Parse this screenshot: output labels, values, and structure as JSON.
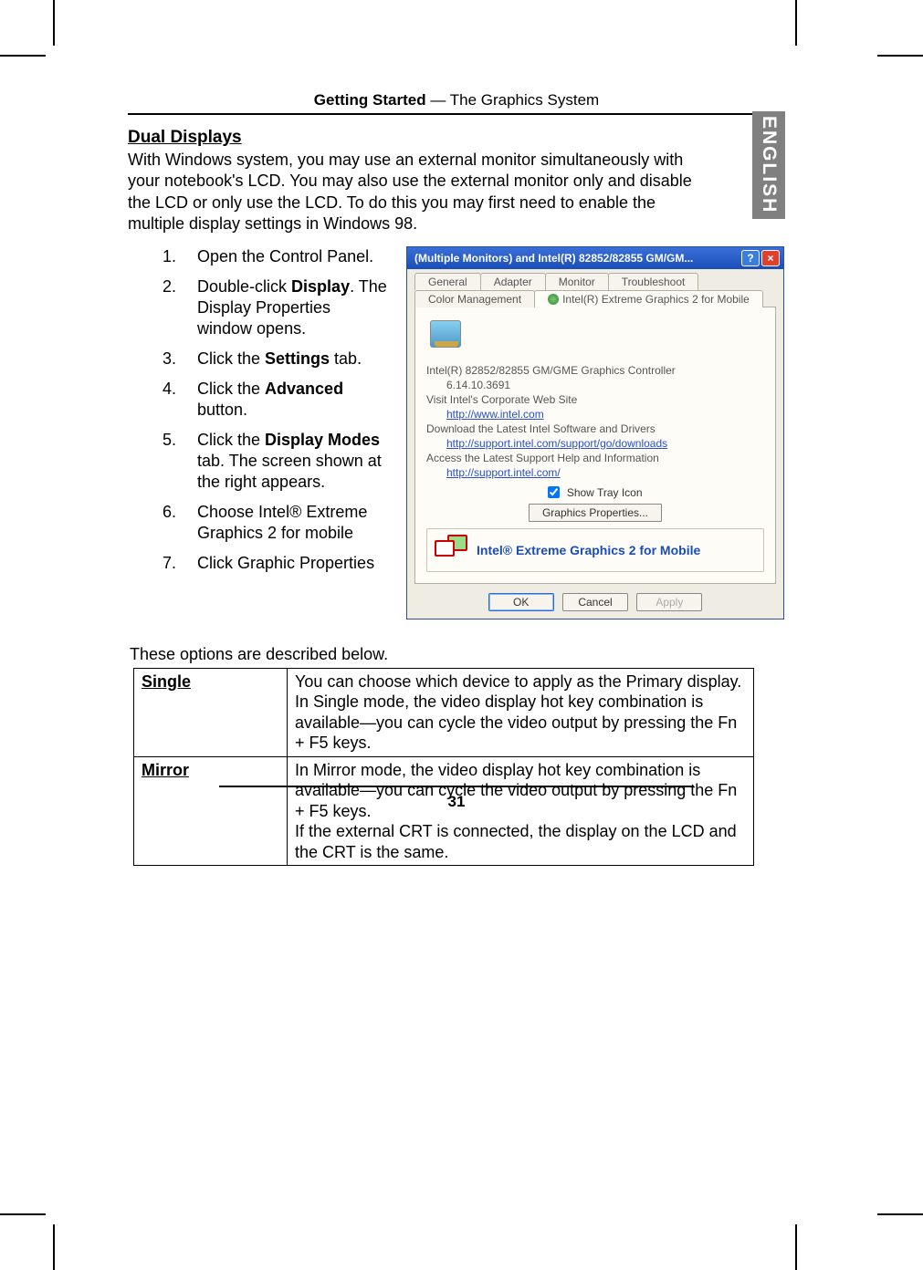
{
  "header": {
    "chapter": "Getting Started",
    "section": "The Graphics System"
  },
  "side_tab": "ENGLISH",
  "title": "Dual Displays",
  "intro": "With Windows system, you may use an external monitor simultaneously with your notebook's LCD. You may also use the external monitor only and disable the LCD or only use the LCD. To do this you may first need to enable the multiple display settings in Windows 98.",
  "steps": [
    {
      "n": "1.",
      "html": "Open the Control Panel."
    },
    {
      "n": "2.",
      "html": "Double-click <b>Display</b>. The Display Properties window opens."
    },
    {
      "n": "3.",
      "html": "Click the <b>Settings</b> tab."
    },
    {
      "n": "4.",
      "html": "Click the <b>Advanced</b> button."
    },
    {
      "n": "5.",
      "html": "Click the <b>Display Modes</b> tab. The screen shown at the right appears."
    },
    {
      "n": "6.",
      "html": "Choose Intel® Extreme Graphics 2 for mobile"
    },
    {
      "n": "7.",
      "html": "Click Graphic Properties"
    }
  ],
  "dialog": {
    "title": "(Multiple Monitors) and Intel(R) 82852/82855 GM/GM...",
    "tabs_row1": [
      "General",
      "Adapter",
      "Monitor",
      "Troubleshoot"
    ],
    "tabs_row2": [
      "Color Management",
      "Intel(R) Extreme Graphics 2 for Mobile"
    ],
    "controller": "Intel(R) 82852/82855 GM/GME Graphics Controller",
    "version": "6.14.10.3691",
    "visit_label": "Visit Intel's Corporate Web Site",
    "visit_link": "http://www.intel.com",
    "download_label": "Download the Latest Intel Software and Drivers",
    "download_link": "http://support.intel.com/support/go/downloads",
    "support_label": "Access the Latest Support Help and Information",
    "support_link": "http://support.intel.com/",
    "tray_label": "Show Tray Icon",
    "gp_button": "Graphics Properties...",
    "brand": "Intel® Extreme Graphics 2 for Mobile",
    "ok": "OK",
    "cancel": "Cancel",
    "apply": "Apply"
  },
  "options_intro": "These options are described below.",
  "options": [
    {
      "k": "Single",
      "v": "You can choose which device to apply as the Primary display.\nIn Single mode, the video display hot key combination is available—you can cycle the video output by pressing the Fn + F5 keys."
    },
    {
      "k": "Mirror",
      "v": "In Mirror mode, the video display hot key combination is available—you can cycle the video output by pressing the Fn + F5 keys.\nIf the external CRT is connected, the display on the LCD and the CRT is the same."
    }
  ],
  "page_number": "31"
}
